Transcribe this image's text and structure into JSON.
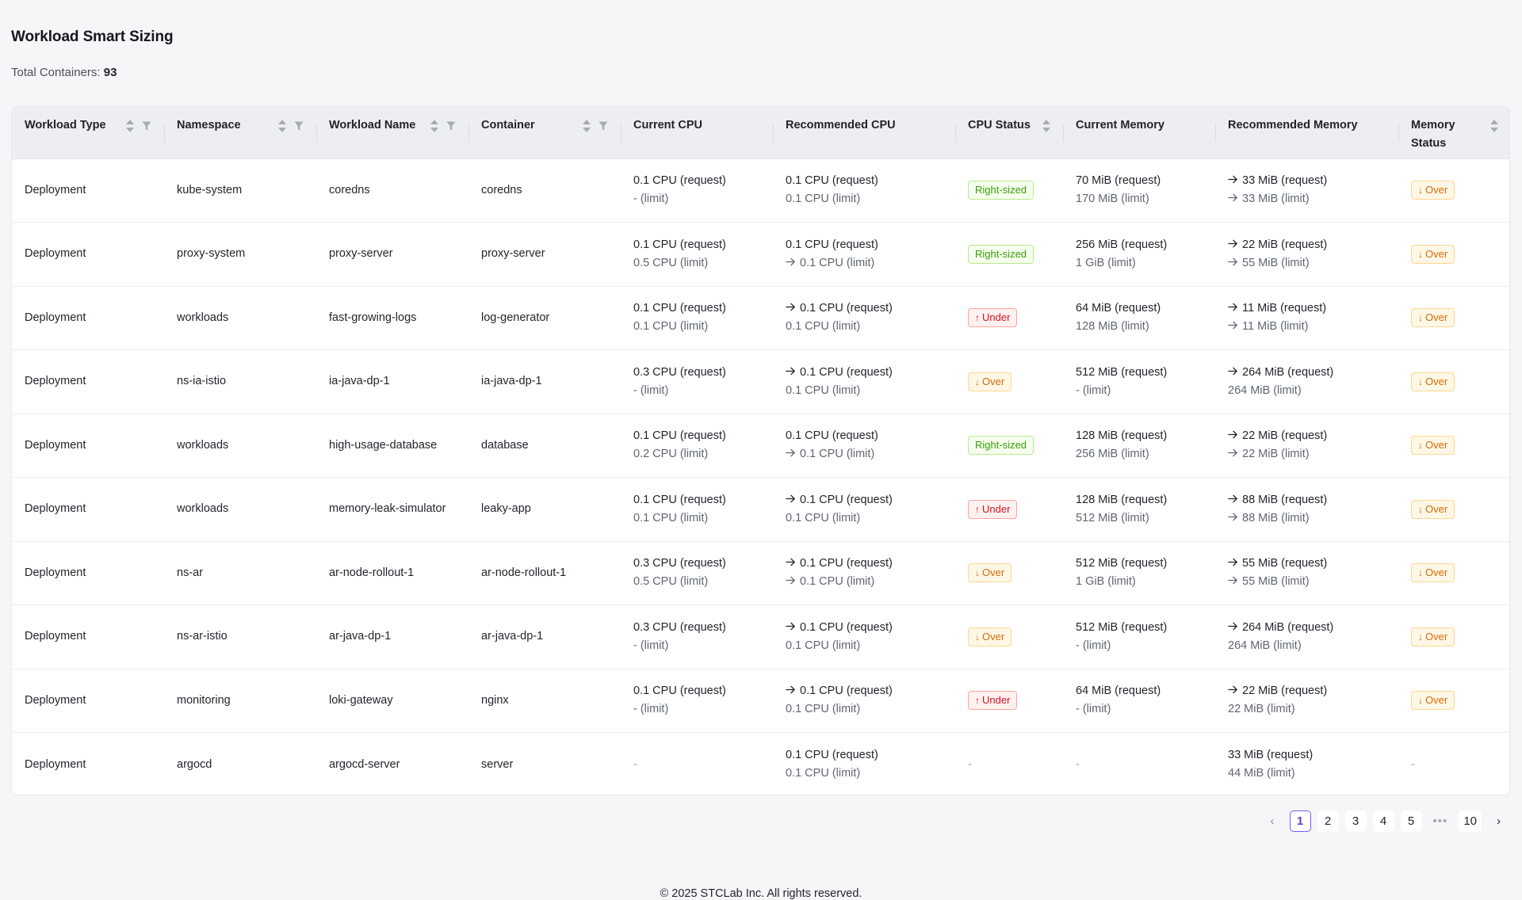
{
  "page": {
    "title": "Workload Smart Sizing",
    "total_label": "Total Containers:",
    "total_value": "93"
  },
  "columns": [
    {
      "label": "Workload Type",
      "sortable": true,
      "filterable": true
    },
    {
      "label": "Namespace",
      "sortable": true,
      "filterable": true
    },
    {
      "label": "Workload Name",
      "sortable": true,
      "filterable": true
    },
    {
      "label": "Container",
      "sortable": true,
      "filterable": true
    },
    {
      "label": "Current CPU",
      "sortable": false,
      "filterable": false
    },
    {
      "label": "Recommended CPU",
      "sortable": false,
      "filterable": false
    },
    {
      "label": "CPU Status",
      "sortable": true,
      "filterable": false
    },
    {
      "label": "Current Memory",
      "sortable": false,
      "filterable": false
    },
    {
      "label": "Recommended Memory",
      "sortable": false,
      "filterable": false
    },
    {
      "label": "Memory Status",
      "sortable": true,
      "filterable": false
    }
  ],
  "status_labels": {
    "ok": "Right-sized",
    "under": "Under",
    "over": "Over"
  },
  "rows": [
    {
      "type": "Deployment",
      "namespace": "kube-system",
      "workload": "coredns",
      "container": "coredns",
      "cur_cpu": {
        "req": "0.1 CPU (request)",
        "lim": "- (limit)"
      },
      "rec_cpu": {
        "req": "0.1 CPU (request)",
        "req_arrow": false,
        "lim": "0.1 CPU (limit)",
        "lim_arrow": false
      },
      "cpu_status": "ok",
      "cur_mem": {
        "req": "70 MiB (request)",
        "lim": "170 MiB (limit)"
      },
      "rec_mem": {
        "req": "33 MiB (request)",
        "req_arrow": true,
        "lim": "33 MiB (limit)",
        "lim_arrow": true
      },
      "mem_status": "over"
    },
    {
      "type": "Deployment",
      "namespace": "proxy-system",
      "workload": "proxy-server",
      "container": "proxy-server",
      "cur_cpu": {
        "req": "0.1 CPU (request)",
        "lim": "0.5 CPU (limit)"
      },
      "rec_cpu": {
        "req": "0.1 CPU (request)",
        "req_arrow": false,
        "lim": "0.1 CPU (limit)",
        "lim_arrow": true
      },
      "cpu_status": "ok",
      "cur_mem": {
        "req": "256 MiB (request)",
        "lim": "1 GiB (limit)"
      },
      "rec_mem": {
        "req": "22 MiB (request)",
        "req_arrow": true,
        "lim": "55 MiB (limit)",
        "lim_arrow": true
      },
      "mem_status": "over"
    },
    {
      "type": "Deployment",
      "namespace": "workloads",
      "workload": "fast-growing-logs",
      "container": "log-generator",
      "cur_cpu": {
        "req": "0.1 CPU (request)",
        "lim": "0.1 CPU (limit)"
      },
      "rec_cpu": {
        "req": "0.1 CPU (request)",
        "req_arrow": true,
        "lim": "0.1 CPU (limit)",
        "lim_arrow": false
      },
      "cpu_status": "under",
      "cur_mem": {
        "req": "64 MiB (request)",
        "lim": "128 MiB (limit)"
      },
      "rec_mem": {
        "req": "11 MiB (request)",
        "req_arrow": true,
        "lim": "11 MiB (limit)",
        "lim_arrow": true
      },
      "mem_status": "over"
    },
    {
      "type": "Deployment",
      "namespace": "ns-ia-istio",
      "workload": "ia-java-dp-1",
      "container": "ia-java-dp-1",
      "cur_cpu": {
        "req": "0.3 CPU (request)",
        "lim": "- (limit)"
      },
      "rec_cpu": {
        "req": "0.1 CPU (request)",
        "req_arrow": true,
        "lim": "0.1 CPU (limit)",
        "lim_arrow": false
      },
      "cpu_status": "over",
      "cur_mem": {
        "req": "512 MiB (request)",
        "lim": "- (limit)"
      },
      "rec_mem": {
        "req": "264 MiB (request)",
        "req_arrow": true,
        "lim": "264 MiB (limit)",
        "lim_arrow": false
      },
      "mem_status": "over"
    },
    {
      "type": "Deployment",
      "namespace": "workloads",
      "workload": "high-usage-database",
      "container": "database",
      "cur_cpu": {
        "req": "0.1 CPU (request)",
        "lim": "0.2 CPU (limit)"
      },
      "rec_cpu": {
        "req": "0.1 CPU (request)",
        "req_arrow": false,
        "lim": "0.1 CPU (limit)",
        "lim_arrow": true
      },
      "cpu_status": "ok",
      "cur_mem": {
        "req": "128 MiB (request)",
        "lim": "256 MiB (limit)"
      },
      "rec_mem": {
        "req": "22 MiB (request)",
        "req_arrow": true,
        "lim": "22 MiB (limit)",
        "lim_arrow": true
      },
      "mem_status": "over"
    },
    {
      "type": "Deployment",
      "namespace": "workloads",
      "workload": "memory-leak-simulator",
      "container": "leaky-app",
      "cur_cpu": {
        "req": "0.1 CPU (request)",
        "lim": "0.1 CPU (limit)"
      },
      "rec_cpu": {
        "req": "0.1 CPU (request)",
        "req_arrow": true,
        "lim": "0.1 CPU (limit)",
        "lim_arrow": false
      },
      "cpu_status": "under",
      "cur_mem": {
        "req": "128 MiB (request)",
        "lim": "512 MiB (limit)"
      },
      "rec_mem": {
        "req": "88 MiB (request)",
        "req_arrow": true,
        "lim": "88 MiB (limit)",
        "lim_arrow": true
      },
      "mem_status": "over"
    },
    {
      "type": "Deployment",
      "namespace": "ns-ar",
      "workload": "ar-node-rollout-1",
      "container": "ar-node-rollout-1",
      "cur_cpu": {
        "req": "0.3 CPU (request)",
        "lim": "0.5 CPU (limit)"
      },
      "rec_cpu": {
        "req": "0.1 CPU (request)",
        "req_arrow": true,
        "lim": "0.1 CPU (limit)",
        "lim_arrow": true
      },
      "cpu_status": "over",
      "cur_mem": {
        "req": "512 MiB (request)",
        "lim": "1 GiB (limit)"
      },
      "rec_mem": {
        "req": "55 MiB (request)",
        "req_arrow": true,
        "lim": "55 MiB (limit)",
        "lim_arrow": true
      },
      "mem_status": "over"
    },
    {
      "type": "Deployment",
      "namespace": "ns-ar-istio",
      "workload": "ar-java-dp-1",
      "container": "ar-java-dp-1",
      "cur_cpu": {
        "req": "0.3 CPU (request)",
        "lim": "- (limit)"
      },
      "rec_cpu": {
        "req": "0.1 CPU (request)",
        "req_arrow": true,
        "lim": "0.1 CPU (limit)",
        "lim_arrow": false
      },
      "cpu_status": "over",
      "cur_mem": {
        "req": "512 MiB (request)",
        "lim": "- (limit)"
      },
      "rec_mem": {
        "req": "264 MiB (request)",
        "req_arrow": true,
        "lim": "264 MiB (limit)",
        "lim_arrow": false
      },
      "mem_status": "over"
    },
    {
      "type": "Deployment",
      "namespace": "monitoring",
      "workload": "loki-gateway",
      "container": "nginx",
      "cur_cpu": {
        "req": "0.1 CPU (request)",
        "lim": "- (limit)"
      },
      "rec_cpu": {
        "req": "0.1 CPU (request)",
        "req_arrow": true,
        "lim": "0.1 CPU (limit)",
        "lim_arrow": false
      },
      "cpu_status": "under",
      "cur_mem": {
        "req": "64 MiB (request)",
        "lim": "- (limit)"
      },
      "rec_mem": {
        "req": "22 MiB (request)",
        "req_arrow": true,
        "lim": "22 MiB (limit)",
        "lim_arrow": false
      },
      "mem_status": "over"
    },
    {
      "type": "Deployment",
      "namespace": "argocd",
      "workload": "argocd-server",
      "container": "server",
      "cur_cpu": null,
      "rec_cpu": {
        "req": "0.1 CPU (request)",
        "req_arrow": false,
        "lim": "0.1 CPU (limit)",
        "lim_arrow": false
      },
      "cpu_status": null,
      "cur_mem": null,
      "rec_mem": {
        "req": "33 MiB (request)",
        "req_arrow": false,
        "lim": "44 MiB (limit)",
        "lim_arrow": false
      },
      "mem_status": null
    }
  ],
  "empty_value": "-",
  "pagination": {
    "pages": [
      "1",
      "2",
      "3",
      "4",
      "5"
    ],
    "dots": "•••",
    "last": "10",
    "current": "1",
    "prev": "‹",
    "next": "›"
  },
  "footer": "© 2025 STCLab Inc. All rights reserved.",
  "colors": {
    "accent": "#7a5af8",
    "ok": "#389e0d",
    "under": "#cf1322",
    "over": "#d46b08",
    "header_bg": "#eceef1"
  }
}
